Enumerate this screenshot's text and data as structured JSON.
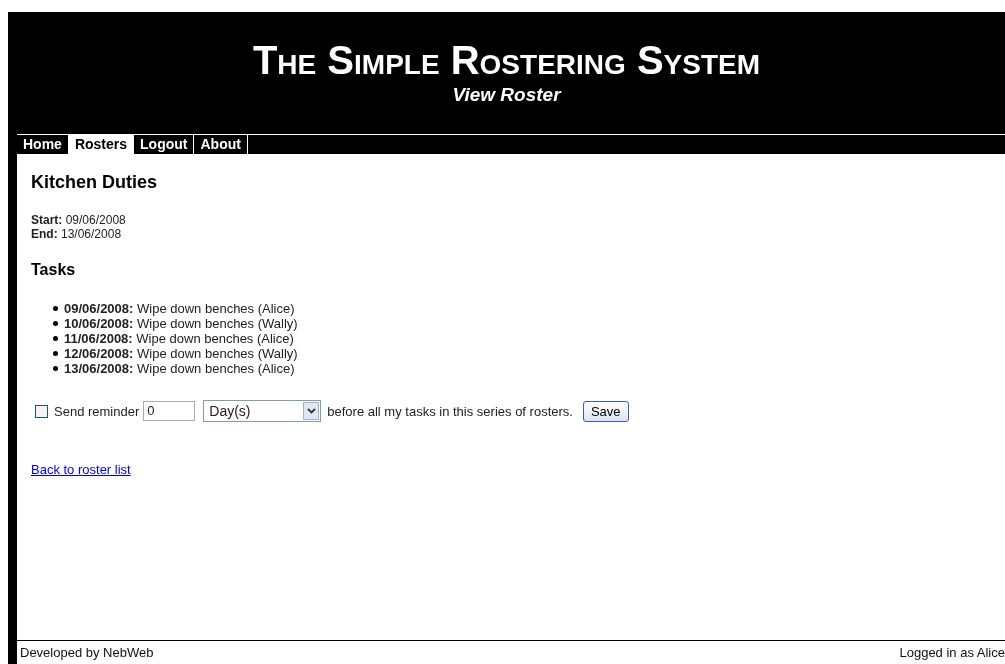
{
  "header": {
    "title": "The Simple Rostering System",
    "subtitle": "View Roster"
  },
  "nav": [
    {
      "label": "Home",
      "selected": false
    },
    {
      "label": "Rosters",
      "selected": true
    },
    {
      "label": "Logout",
      "selected": false
    },
    {
      "label": "About",
      "selected": false
    }
  ],
  "roster": {
    "title": "Kitchen Duties",
    "start_label": "Start:",
    "start": "09/06/2008",
    "end_label": "End:",
    "end": "13/06/2008"
  },
  "tasks": {
    "heading": "Tasks",
    "items": [
      {
        "date": "09/06/2008:",
        "text": "Wipe down benches (Alice)"
      },
      {
        "date": "10/06/2008:",
        "text": "Wipe down benches (Wally)"
      },
      {
        "date": "11/06/2008:",
        "text": "Wipe down benches (Alice)"
      },
      {
        "date": "12/06/2008:",
        "text": "Wipe down benches (Wally)"
      },
      {
        "date": "13/06/2008:",
        "text": "Wipe down benches (Alice)"
      }
    ]
  },
  "reminder": {
    "checked": false,
    "label": "Send reminder",
    "amount": "0",
    "unit": "Day(s)",
    "suffix": "before all my tasks in this series of rosters.",
    "button": "Save"
  },
  "back_link": "Back to roster list",
  "footer": {
    "left": "Developed by NebWeb",
    "right": "Logged in as Alice"
  }
}
